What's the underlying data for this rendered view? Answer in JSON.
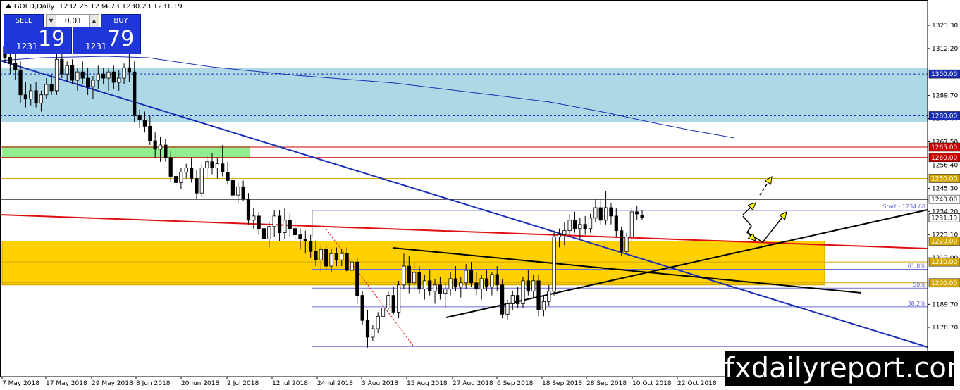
{
  "window": {
    "title": "GOLD,Daily",
    "ohlc": "1232.25 1234.73 1230.23 1231.19"
  },
  "trade_panel": {
    "sell_label": "SELL",
    "buy_label": "BUY",
    "lot": "0.01",
    "sell_small": "1231",
    "sell_big": "19",
    "buy_small": "1231",
    "buy_big": "79"
  },
  "watermark": "fxdailyreport.com",
  "colors": {
    "resistance_zone": "#add8e6",
    "support_zone": "#ffd100",
    "green_zone": "#90ee90",
    "downtrend_line": "#1c2fb8",
    "red_trendline": "#e01010",
    "ma_line": "#1c2fb8",
    "fib_lines": "#6b6bd6",
    "level_red": "#cc0000",
    "level_gold": "#d4a800",
    "annotation_arrow": "#ffff00",
    "current_price_bg": "#ffffff"
  },
  "chart_data": {
    "type": "candlestick",
    "symbol": "GOLD",
    "timeframe": "Daily",
    "x_ticks": [
      "7 May 2018",
      "17 May 2018",
      "29 May 2018",
      "8 Jun 2018",
      "20 Jun 2018",
      "2 Jul 2018",
      "12 Jul 2018",
      "24 Jul 2018",
      "3 Aug 2018",
      "15 Aug 2018",
      "27 Aug 2018",
      "6 Sep 2018",
      "18 Sep 2018",
      "28 Sep 2018",
      "10 Oct 2018",
      "22 Oct 2018"
    ],
    "y_ticks": [
      "1323.30",
      "1312.20",
      "1289.70",
      "1278.60",
      "1267.50",
      "1256.40",
      "1245.30",
      "1234.20",
      "1223.10",
      "1212.00",
      "1189.70",
      "1178.70"
    ],
    "ylim": [
      1166.5,
      1330
    ],
    "levels": [
      {
        "label": "1300.00",
        "value": 1300.0,
        "style": "dotted",
        "color": "#1c2fb8"
      },
      {
        "label": "1280.00",
        "value": 1280.0,
        "style": "dotted",
        "color": "#1c2fb8"
      },
      {
        "label": "1265.00",
        "value": 1265.0,
        "style": "solid",
        "color": "#cc0000"
      },
      {
        "label": "1260.00",
        "value": 1260.0,
        "style": "solid",
        "color": "#cc0000"
      },
      {
        "label": "1250.00",
        "value": 1250.0,
        "style": "solid",
        "color": "#d4a800"
      },
      {
        "label": "1240.00",
        "value": 1240.0,
        "style": "solid",
        "color": "#000000"
      },
      {
        "label": "1220.00",
        "value": 1220.0,
        "style": "solid",
        "color": "#d4a800"
      },
      {
        "label": "1210.00",
        "value": 1210.0,
        "style": "solid",
        "color": "#d4a800"
      },
      {
        "label": "1200.00",
        "value": 1200.0,
        "style": "solid",
        "color": "#d4a800"
      }
    ],
    "current_price": {
      "label": "1231.19",
      "value": 1231.19
    },
    "zones": [
      {
        "name": "resistance-zone",
        "from": 1277.0,
        "to": 1303.0
      },
      {
        "name": "green-zone",
        "from": 1260.0,
        "to": 1265.5
      },
      {
        "name": "support-zone",
        "from": 1199.0,
        "to": 1220.0
      }
    ],
    "fib": {
      "start_label": "Start - 1234.68",
      "levels": [
        {
          "label": "",
          "value": 1234.68
        },
        {
          "label": "61.8%",
          "value": 1206.5
        },
        {
          "label": "50%",
          "value": 1197.5
        },
        {
          "label": "38.2%",
          "value": 1188.5
        },
        {
          "label": "",
          "value": 1169.5
        }
      ]
    },
    "candles": [
      [
        1313,
        1316,
        1305,
        1308
      ],
      [
        1308,
        1312,
        1300,
        1305
      ],
      [
        1305,
        1310,
        1297,
        1302
      ],
      [
        1302,
        1306,
        1286,
        1290
      ],
      [
        1290,
        1296,
        1284,
        1288
      ],
      [
        1288,
        1295,
        1285,
        1292
      ],
      [
        1292,
        1296,
        1284,
        1286
      ],
      [
        1286,
        1292,
        1282,
        1290
      ],
      [
        1290,
        1298,
        1288,
        1295
      ],
      [
        1295,
        1300,
        1290,
        1292
      ],
      [
        1292,
        1310,
        1290,
        1307
      ],
      [
        1307,
        1310,
        1298,
        1300
      ],
      [
        1300,
        1306,
        1296,
        1304
      ],
      [
        1304,
        1307,
        1295,
        1297
      ],
      [
        1297,
        1303,
        1292,
        1301
      ],
      [
        1301,
        1306,
        1295,
        1298
      ],
      [
        1298,
        1303,
        1290,
        1294
      ],
      [
        1294,
        1299,
        1288,
        1297
      ],
      [
        1297,
        1304,
        1293,
        1300
      ],
      [
        1300,
        1303,
        1295,
        1298
      ],
      [
        1298,
        1303,
        1292,
        1301
      ],
      [
        1301,
        1304,
        1293,
        1296
      ],
      [
        1296,
        1302,
        1292,
        1298
      ],
      [
        1298,
        1305,
        1295,
        1303
      ],
      [
        1303,
        1310,
        1296,
        1301
      ],
      [
        1301,
        1306,
        1277,
        1280
      ],
      [
        1280,
        1283,
        1274,
        1278
      ],
      [
        1278,
        1282,
        1272,
        1275
      ],
      [
        1275,
        1280,
        1266,
        1268
      ],
      [
        1268,
        1272,
        1260,
        1264
      ],
      [
        1264,
        1270,
        1258,
        1266
      ],
      [
        1266,
        1269,
        1258,
        1260
      ],
      [
        1260,
        1263,
        1248,
        1251
      ],
      [
        1251,
        1256,
        1246,
        1248
      ],
      [
        1248,
        1255,
        1245,
        1253
      ],
      [
        1253,
        1257,
        1250,
        1255
      ],
      [
        1255,
        1260,
        1248,
        1250
      ],
      [
        1250,
        1254,
        1240,
        1243
      ],
      [
        1243,
        1257,
        1241,
        1255
      ],
      [
        1255,
        1261,
        1250,
        1258
      ],
      [
        1258,
        1262,
        1252,
        1255
      ],
      [
        1255,
        1260,
        1250,
        1257
      ],
      [
        1257,
        1266,
        1251,
        1253
      ],
      [
        1253,
        1258,
        1247,
        1249
      ],
      [
        1249,
        1251,
        1240,
        1242
      ],
      [
        1242,
        1248,
        1238,
        1246
      ],
      [
        1246,
        1249,
        1239,
        1240
      ],
      [
        1240,
        1243,
        1228,
        1230
      ],
      [
        1230,
        1236,
        1226,
        1232
      ],
      [
        1232,
        1234,
        1223,
        1226
      ],
      [
        1226,
        1232,
        1210,
        1221
      ],
      [
        1221,
        1229,
        1217,
        1227
      ],
      [
        1227,
        1235,
        1222,
        1232
      ],
      [
        1232,
        1235,
        1220,
        1224
      ],
      [
        1224,
        1236,
        1221,
        1230
      ],
      [
        1230,
        1233,
        1222,
        1226
      ],
      [
        1226,
        1230,
        1220,
        1223
      ],
      [
        1223,
        1226,
        1216,
        1221
      ],
      [
        1221,
        1225,
        1214,
        1220
      ],
      [
        1220,
        1223,
        1212,
        1215
      ],
      [
        1215,
        1220,
        1208,
        1211
      ],
      [
        1211,
        1218,
        1205,
        1216
      ],
      [
        1216,
        1218,
        1206,
        1208
      ],
      [
        1208,
        1216,
        1205,
        1214
      ],
      [
        1214,
        1217,
        1208,
        1211
      ],
      [
        1211,
        1216,
        1208,
        1214
      ],
      [
        1214,
        1217,
        1205,
        1206
      ],
      [
        1206,
        1212,
        1204,
        1210
      ],
      [
        1210,
        1212,
        1190,
        1194
      ],
      [
        1194,
        1196,
        1180,
        1182
      ],
      [
        1182,
        1187,
        1169,
        1174
      ],
      [
        1174,
        1180,
        1172,
        1178
      ],
      [
        1178,
        1186,
        1176,
        1184
      ],
      [
        1184,
        1191,
        1182,
        1188
      ],
      [
        1188,
        1196,
        1187,
        1194
      ],
      [
        1194,
        1198,
        1185,
        1186
      ],
      [
        1186,
        1201,
        1183,
        1199
      ],
      [
        1199,
        1214,
        1197,
        1208
      ],
      [
        1208,
        1213,
        1195,
        1200
      ],
      [
        1200,
        1210,
        1196,
        1205
      ],
      [
        1205,
        1208,
        1195,
        1197
      ],
      [
        1197,
        1204,
        1192,
        1201
      ],
      [
        1201,
        1206,
        1194,
        1196
      ],
      [
        1196,
        1202,
        1190,
        1199
      ],
      [
        1199,
        1203,
        1192,
        1195
      ],
      [
        1195,
        1200,
        1188,
        1197
      ],
      [
        1197,
        1205,
        1194,
        1202
      ],
      [
        1202,
        1208,
        1196,
        1198
      ],
      [
        1198,
        1203,
        1193,
        1200
      ],
      [
        1200,
        1209,
        1197,
        1206
      ],
      [
        1206,
        1210,
        1198,
        1200
      ],
      [
        1200,
        1205,
        1194,
        1197
      ],
      [
        1197,
        1204,
        1192,
        1202
      ],
      [
        1202,
        1206,
        1196,
        1198
      ],
      [
        1198,
        1205,
        1194,
        1204
      ],
      [
        1204,
        1208,
        1196,
        1199
      ],
      [
        1199,
        1202,
        1183,
        1185
      ],
      [
        1185,
        1192,
        1182,
        1190
      ],
      [
        1190,
        1196,
        1187,
        1194
      ],
      [
        1194,
        1198,
        1188,
        1190
      ],
      [
        1190,
        1203,
        1188,
        1201
      ],
      [
        1201,
        1206,
        1194,
        1196
      ],
      [
        1196,
        1204,
        1193,
        1201
      ],
      [
        1201,
        1204,
        1184,
        1187
      ],
      [
        1187,
        1194,
        1184,
        1191
      ],
      [
        1191,
        1199,
        1189,
        1196
      ],
      [
        1196,
        1225,
        1194,
        1222
      ],
      [
        1222,
        1226,
        1217,
        1223
      ],
      [
        1223,
        1229,
        1218,
        1225
      ],
      [
        1225,
        1233,
        1222,
        1230
      ],
      [
        1230,
        1234,
        1224,
        1226
      ],
      [
        1226,
        1231,
        1221,
        1228
      ],
      [
        1228,
        1232,
        1223,
        1226
      ],
      [
        1226,
        1233,
        1224,
        1231
      ],
      [
        1231,
        1240,
        1229,
        1236
      ],
      [
        1236,
        1240,
        1228,
        1230
      ],
      [
        1230,
        1244,
        1228,
        1236
      ],
      [
        1236,
        1238,
        1228,
        1232
      ],
      [
        1232,
        1236,
        1222,
        1225
      ],
      [
        1225,
        1227,
        1213,
        1215
      ],
      [
        1215,
        1224,
        1214,
        1222
      ],
      [
        1222,
        1236,
        1220,
        1234
      ],
      [
        1234,
        1237,
        1230,
        1233
      ],
      [
        1232.25,
        1234.73,
        1230.23,
        1231.19
      ]
    ]
  }
}
